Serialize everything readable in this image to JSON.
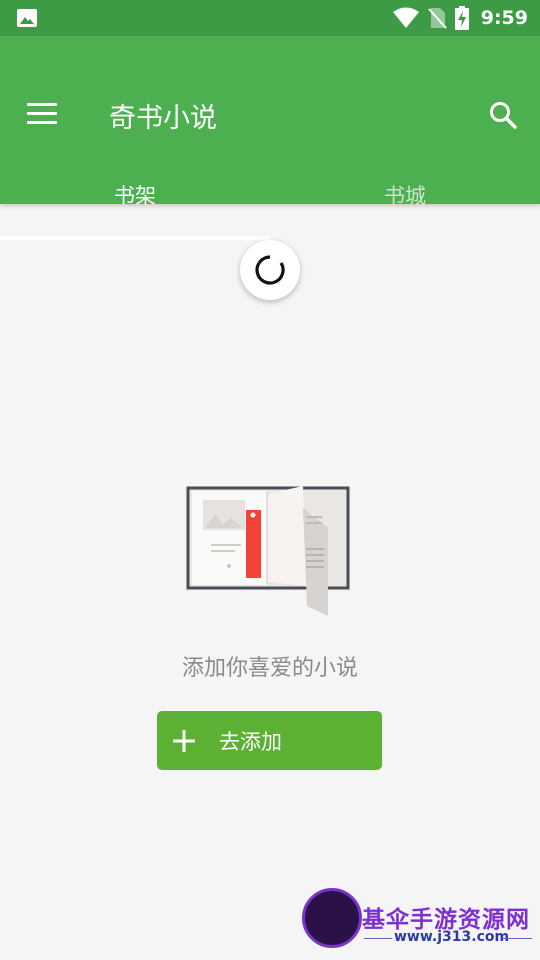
{
  "status_bar": {
    "time": "9:59",
    "icons": [
      "image-icon",
      "wifi-icon",
      "no-sim-icon",
      "battery-charging-icon"
    ]
  },
  "app_bar": {
    "title": "奇书小说",
    "menu_icon": "menu-icon",
    "search_icon": "search-icon"
  },
  "tabs": [
    {
      "label": "书架",
      "active": true
    },
    {
      "label": "书城",
      "active": false
    }
  ],
  "main": {
    "empty_message": "添加你喜爱的小说",
    "add_button_label": "去添加",
    "add_button_icon": "plus-icon"
  },
  "watermark": {
    "title": "基伞手游资源网",
    "url": "www.j313.com"
  },
  "colors": {
    "status_bar": "#3c9b44",
    "app_bar": "#4caf50",
    "button": "#5cb033",
    "background": "#f5f5f5"
  }
}
